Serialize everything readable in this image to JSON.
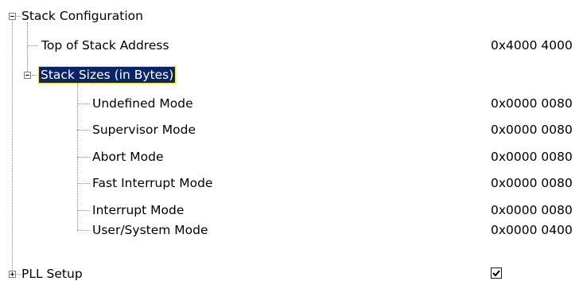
{
  "tree": {
    "stack_configuration": {
      "label": "Stack Configuration",
      "top_of_stack": {
        "label": "Top of Stack Address",
        "value": "0x4000 4000"
      },
      "stack_sizes": {
        "label": "Stack Sizes (in Bytes)",
        "items": [
          {
            "label": "Undefined Mode",
            "value": "0x0000 0080"
          },
          {
            "label": "Supervisor Mode",
            "value": "0x0000 0080"
          },
          {
            "label": "Abort Mode",
            "value": "0x0000 0080"
          },
          {
            "label": "Fast Interrupt Mode",
            "value": "0x0000 0080"
          },
          {
            "label": "Interrupt Mode",
            "value": "0x0000 0080"
          },
          {
            "label": "User/System Mode",
            "value": "0x0000 0400"
          }
        ]
      }
    },
    "pll_setup": {
      "label": "PLL Setup",
      "checked": true
    }
  },
  "colors": {
    "selection_bg": "#0a246a",
    "selection_text": "#ffffff",
    "tree_lines": "#8a8a8a"
  },
  "icons": {
    "expanded": "minus-box-icon",
    "collapsed": "plus-box-icon",
    "check": "checkmark-icon"
  }
}
